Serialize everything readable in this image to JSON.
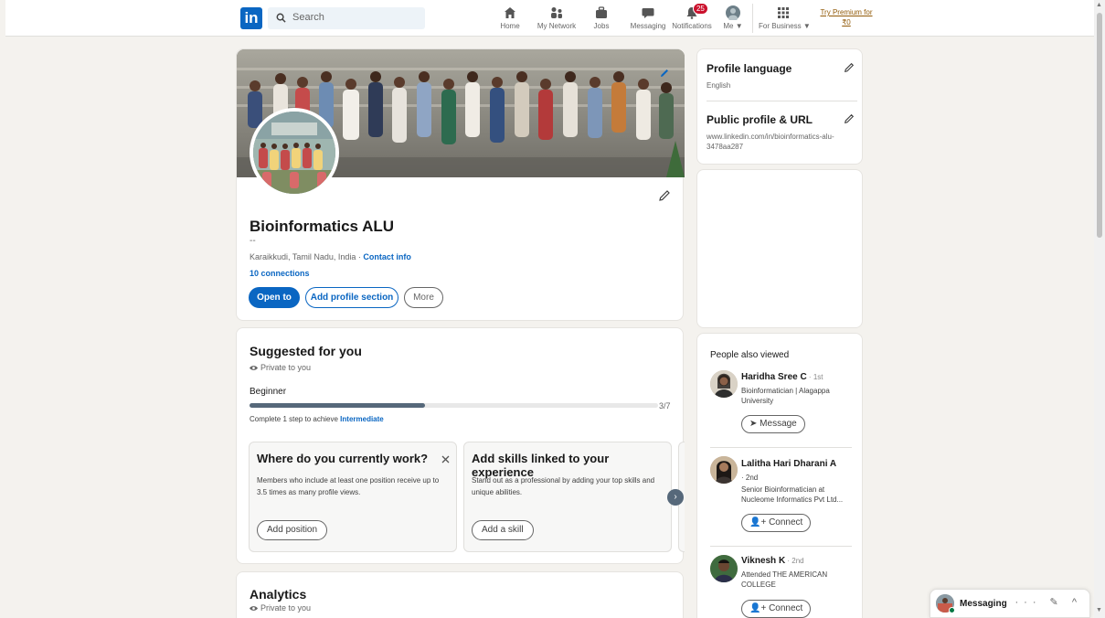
{
  "nav": {
    "logo": "in",
    "search_placeholder": "Search",
    "items": [
      {
        "label": "Home",
        "icon": "home-icon"
      },
      {
        "label": "My Network",
        "icon": "network-icon"
      },
      {
        "label": "Jobs",
        "icon": "briefcase-icon"
      },
      {
        "label": "Messaging",
        "icon": "chat-icon"
      },
      {
        "label": "Notifications",
        "icon": "bell-icon",
        "badge": "25"
      },
      {
        "label": "Me ▼",
        "icon": "avatar"
      },
      {
        "label": "For Business ▼",
        "icon": "grid-icon"
      }
    ],
    "premium": "Try Premium for ₹0"
  },
  "profile": {
    "name": "Bioinformatics ALU",
    "headline": "--",
    "location": "Karaikkudi, Tamil Nadu, India",
    "separator": " · ",
    "contact_info": "Contact info",
    "connections": "10 connections",
    "buttons": {
      "open_to": "Open to",
      "add_section": "Add profile section",
      "more": "More"
    }
  },
  "suggested": {
    "title": "Suggested for you",
    "private": "Private to you",
    "level": "Beginner",
    "progress_label": "3/7",
    "progress_fraction": 0.43,
    "complete_prefix": "Complete 1 step to achieve ",
    "complete_target": "Intermediate",
    "cards": [
      {
        "title": "Where do you currently work?",
        "desc": "Members who include at least one position receive up to 3.5 times as many profile views.",
        "button": "Add position"
      },
      {
        "title": "Add skills linked to your experience",
        "desc": "Stand out as a professional by adding your top skills and unique abilities.",
        "button": "Add a skill"
      }
    ]
  },
  "analytics": {
    "title": "Analytics",
    "private": "Private to you"
  },
  "sidebar": {
    "language_title": "Profile language",
    "language_value": "English",
    "url_title": "Public profile & URL",
    "url_value": "www.linkedin.com/in/bioinformatics-alu-3478aa287",
    "people_title": "People also viewed",
    "people": [
      {
        "name": "Haridha Sree C",
        "degree": " · 1st",
        "headline": "Bioinformatician | Alagappa University",
        "action": "Message"
      },
      {
        "name": "Lalitha Hari Dharani A",
        "degree": " · 2nd",
        "headline": "Senior Bioinformatician at Nucleome Informatics Pvt Ltd...",
        "action": "Connect"
      },
      {
        "name": "Viknesh K",
        "degree": " · 2nd",
        "headline": "Attended THE AMERICAN COLLEGE",
        "action": "Connect"
      }
    ]
  },
  "messaging": {
    "label": "Messaging",
    "icons": "··· ✎ ^"
  },
  "colors": {
    "brand": "#0a66c2",
    "badge": "#cb112d",
    "premium": "#915907"
  }
}
